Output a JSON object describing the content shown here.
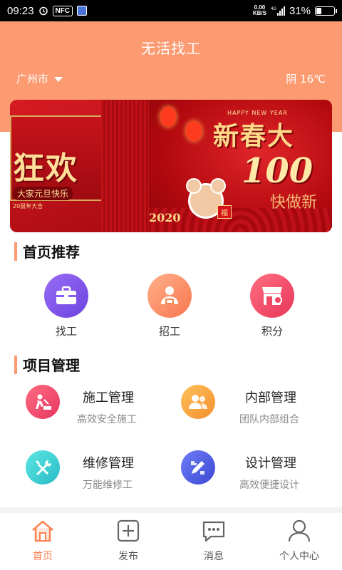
{
  "status_bar": {
    "time": "09:23",
    "nfc": "NFC",
    "net_speed_top": "0.00",
    "net_speed_bottom": "KB/S",
    "network": "4G",
    "battery": "31%",
    "battery_level": 0.31
  },
  "header": {
    "title": "无活找工",
    "city": "广州市",
    "weather": "阴 16℃",
    "background_color": "#fc9a71"
  },
  "banner": {
    "left_text": "狂欢",
    "left_sub": "大家元旦快乐",
    "left_small": "20鼠年大吉",
    "right_en": "HAPPY NEW YEAR",
    "right_title": "新春大",
    "right_big": "100",
    "right_small": "快做新",
    "year": "2020",
    "fu": "福"
  },
  "recommend": {
    "title": "首页推荐",
    "items": [
      {
        "label": "找工",
        "icon": "briefcase-icon",
        "color": "#7a55e8"
      },
      {
        "label": "招工",
        "icon": "worker-icon",
        "color": "#fb8f6a"
      },
      {
        "label": "积分",
        "icon": "shop-icon",
        "color": "#f2506a"
      }
    ]
  },
  "projects": {
    "title": "项目管理",
    "items": [
      {
        "title": "施工管理",
        "sub": "高效安全施工",
        "icon": "construction-icon",
        "color": "#ef4d6e"
      },
      {
        "title": "内部管理",
        "sub": "团队内部组合",
        "icon": "team-icon",
        "color": "#f8a642"
      },
      {
        "title": "维修管理",
        "sub": "万能维修工",
        "icon": "tools-icon",
        "color": "#3dd0d0"
      },
      {
        "title": "设计管理",
        "sub": "高效便捷设计",
        "icon": "design-icon",
        "color": "#4e5ee0"
      }
    ]
  },
  "nav": {
    "items": [
      {
        "label": "首页",
        "icon": "home-icon",
        "active": true
      },
      {
        "label": "发布",
        "icon": "add-icon",
        "active": false
      },
      {
        "label": "消息",
        "icon": "message-icon",
        "active": false
      },
      {
        "label": "个人中心",
        "icon": "user-icon",
        "active": false
      }
    ],
    "active_color": "#fc8252"
  }
}
